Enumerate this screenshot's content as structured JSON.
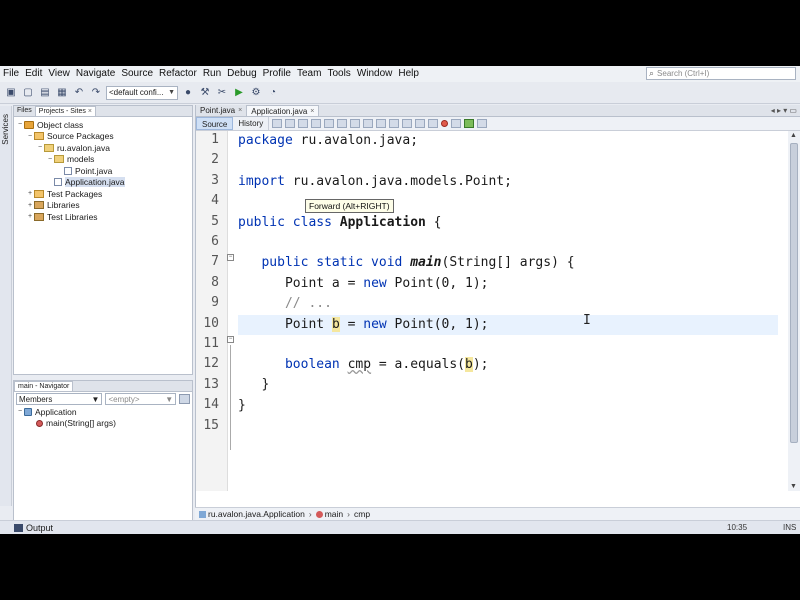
{
  "menu": [
    "File",
    "Edit",
    "View",
    "Navigate",
    "Source",
    "Refactor",
    "Run",
    "Debug",
    "Profile",
    "Team",
    "Tools",
    "Window",
    "Help"
  ],
  "search": {
    "placeholder": "Search (Ctrl+I)"
  },
  "toolbar": {
    "config": "<default confi..."
  },
  "services_label": "Services",
  "projects_panel": {
    "tabs": [
      "Files",
      "Projects - Sites"
    ],
    "tree": [
      {
        "label": "Object class",
        "toggle": "−",
        "indent": 0,
        "icon": "proj"
      },
      {
        "label": "Source Packages",
        "toggle": "−",
        "indent": 1,
        "icon": "pkgs"
      },
      {
        "label": "ru.avalon.java",
        "toggle": "−",
        "indent": 2,
        "icon": "pkg"
      },
      {
        "label": "models",
        "toggle": "−",
        "indent": 3,
        "icon": "pkg"
      },
      {
        "label": "Point.java",
        "toggle": "",
        "indent": 4,
        "icon": "file"
      },
      {
        "label": "Application.java",
        "toggle": "",
        "indent": 3,
        "icon": "file",
        "selected": true
      },
      {
        "label": "Test Packages",
        "toggle": "+",
        "indent": 1,
        "icon": "pkgs"
      },
      {
        "label": "Libraries",
        "toggle": "+",
        "indent": 1,
        "icon": "lib"
      },
      {
        "label": "Test Libraries",
        "toggle": "+",
        "indent": 1,
        "icon": "lib"
      }
    ]
  },
  "navigator": {
    "title": "main - Navigator",
    "members": "Members",
    "filter": "<empty>",
    "tree": [
      {
        "label": "Application",
        "toggle": "−",
        "indent": 0,
        "icon": "cls"
      },
      {
        "label": "main(String[] args)",
        "toggle": "",
        "indent": 1,
        "icon": "meth"
      }
    ]
  },
  "editor": {
    "tabs": [
      "Point.java",
      "Application.java"
    ],
    "views": [
      "Source",
      "History"
    ],
    "tooltip": "Forward (Alt+RIGHT)",
    "line_numbers": [
      "1",
      "2",
      "3",
      "4",
      "5",
      "6",
      "7",
      "8",
      "9",
      "10",
      "11",
      "12",
      "13",
      "14",
      "15"
    ],
    "code": {
      "l1_kw": "package",
      "l1_rest": " ru.avalon.java;",
      "l3_kw": "import",
      "l3_rest": " ru.avalon.java.models.Point;",
      "l5_kw": "public class",
      "l5_name": "Application",
      "l5_rest": " {",
      "l7_kw": "public static void",
      "l7_name": "main",
      "l7_rest": "(String[] args) {",
      "l8_a": "Point a = ",
      "l8_kw": "new",
      "l8_b": " Point(0, 1);",
      "l9": "// ...",
      "l10_a": "Point ",
      "l10_var": "b",
      "l10_b": " = ",
      "l10_kw": "new",
      "l10_c": " Point(0, 1);",
      "l12_kw": "boolean",
      "l12_a": " ",
      "l12_var": "cmp",
      "l12_b": " = a.equals(",
      "l12_arg": "b",
      "l12_c": ");",
      "l13": "}",
      "l14": "}"
    }
  },
  "breadcrumb": [
    "ru.avalon.java.Application",
    "main",
    "cmp"
  ],
  "status": {
    "output": "Output",
    "position": "10:35",
    "mode": "INS"
  }
}
